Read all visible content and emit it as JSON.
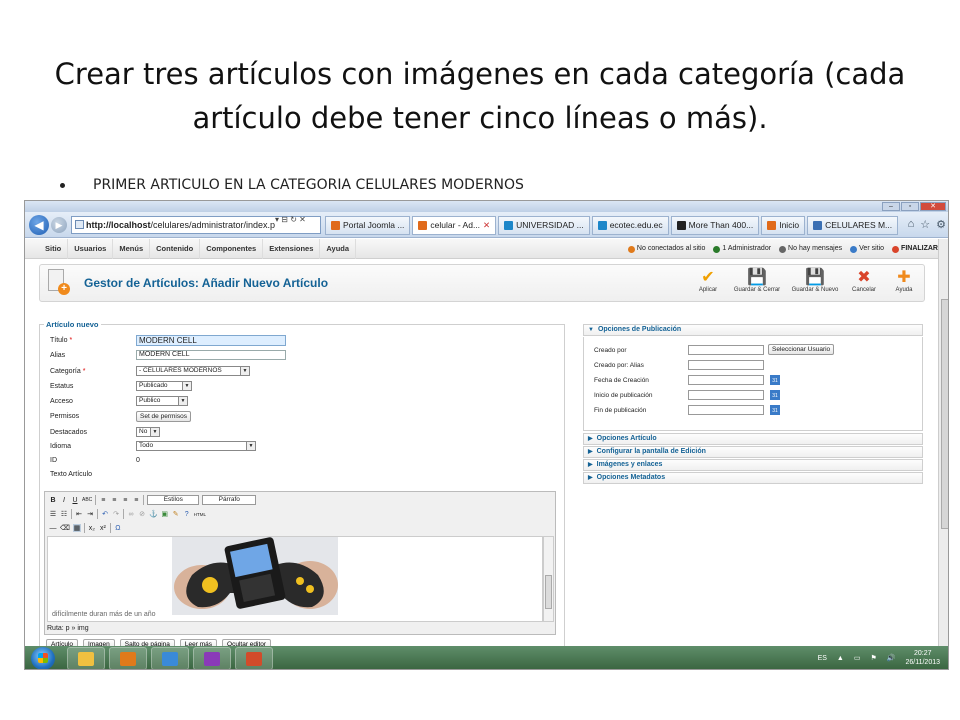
{
  "slide": {
    "title": "Crear tres artículos con imágenes en cada categoría (cada artículo debe tener cinco líneas o más).",
    "bullet": "PRIMER ARTICULO EN LA CATEGORIA  CELULARES MODERNOS"
  },
  "browser": {
    "address_host": "http://localhost",
    "address_path": "/celulares/administrator/index.p",
    "tabs": [
      {
        "label": "Portal Joomla ...",
        "color": "#e06a1b"
      },
      {
        "label": "celular - Ad...",
        "color": "#e06a1b"
      },
      {
        "label": "UNIVERSIDAD ...",
        "color": "#1c86c9"
      },
      {
        "label": "ecotec.edu.ec",
        "color": "#1c86c9"
      },
      {
        "label": "More Than 400...",
        "color": "#222222"
      },
      {
        "label": "Inicio",
        "color": "#e06a1b"
      },
      {
        "label": "CELULARES M...",
        "color": "#3a6fb3"
      }
    ]
  },
  "joomla_menu": {
    "items": [
      "Sitio",
      "Usuarios",
      "Menús",
      "Contenido",
      "Componentes",
      "Extensiones",
      "Ayuda"
    ],
    "status": [
      {
        "label": "No conectados al sitio",
        "color": "#e07a1b"
      },
      {
        "label": "1 Administrador",
        "color": "#2a7a2a"
      },
      {
        "label": "No hay mensajes",
        "color": "#666666"
      },
      {
        "label": "Ver sitio",
        "color": "#3a7bc8"
      },
      {
        "label": "FINALIZAR",
        "color": "#d9442a"
      }
    ]
  },
  "toolbar": {
    "title": "Gestor de Artículos: Añadir Nuevo Artículo",
    "buttons": [
      {
        "label": "Aplicar",
        "icon": "check-icon",
        "glyph": "✔",
        "color": "#f0a000"
      },
      {
        "label": "Guardar & Cerrar",
        "icon": "save-icon",
        "glyph": "💾",
        "color": "#4a5a6a"
      },
      {
        "label": "Guardar & Nuevo",
        "icon": "save-new-icon",
        "glyph": "💾",
        "color": "#4a5a6a"
      },
      {
        "label": "Cancelar",
        "icon": "cancel-icon",
        "glyph": "✖",
        "color": "#d9442a"
      },
      {
        "label": "Ayuda",
        "icon": "help-icon",
        "glyph": "✚",
        "color": "#f08a1c"
      }
    ]
  },
  "form": {
    "legend": "Artículo nuevo",
    "title_label": "Título",
    "title_value": "MODERN CELL",
    "alias_label": "Alias",
    "alias_value": "MODERN CELL",
    "category_label": "Categoría",
    "category_value": "- CELULARES MODERNOS",
    "status_label": "Estatus",
    "status_value": "Publicado",
    "access_label": "Acceso",
    "access_value": "Publico",
    "permissions_label": "Permisos",
    "permissions_button": "Set de permisos",
    "featured_label": "Destacados",
    "featured_value": "No",
    "language_label": "Idioma",
    "language_value": "Todo",
    "id_label": "ID",
    "id_value": "0",
    "text_label": "Texto Artículo",
    "required_mark": "*"
  },
  "editor": {
    "styles_dropdown": "Estilos",
    "format_dropdown": "Párrafo",
    "content_text": "difícilmente duran más de un año",
    "path": "Ruta: p » img",
    "bottom_buttons": [
      "Artículo",
      "Imagen",
      "Salto de página",
      "Leer más",
      "Ocultar editor"
    ]
  },
  "publishing": {
    "header": "Opciones de Publicación",
    "created_by": "Creado por",
    "select_user_button": "Seleccionar Usuario",
    "created_by_alias": "Creado por: Alias",
    "created_date": "Fecha de Creación",
    "publish_up": "Inicio de publicación",
    "publish_down": "Fin de publicación",
    "collapsed_sections": [
      "Opciones Artículo",
      "Configurar la pantalla de Edición",
      "Imágenes y enlaces",
      "Opciones Metadatos"
    ]
  },
  "taskbar": {
    "language": "ES",
    "time": "20:27",
    "date": "26/11/2013",
    "apps": [
      {
        "icon": "folder-icon",
        "color": "#f0c040"
      },
      {
        "icon": "media-player-icon",
        "color": "#e07a1b"
      },
      {
        "icon": "internet-explorer-icon",
        "color": "#3a8ad8"
      },
      {
        "icon": "onenote-icon",
        "color": "#8a3ab8"
      },
      {
        "icon": "powerpoint-icon",
        "color": "#d24b2a"
      }
    ]
  }
}
